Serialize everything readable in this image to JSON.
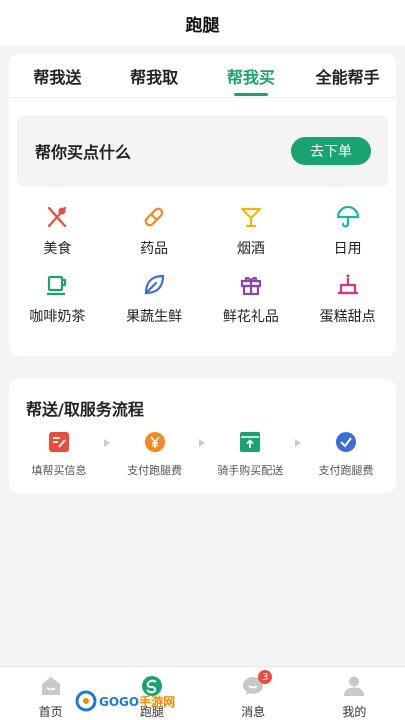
{
  "header": {
    "title": "跑腿"
  },
  "tabs": [
    {
      "label": "帮我送",
      "active": false
    },
    {
      "label": "帮我取",
      "active": false
    },
    {
      "label": "帮我买",
      "active": true
    },
    {
      "label": "全能帮手",
      "active": false
    }
  ],
  "buy_box": {
    "prompt": "帮你买点什么",
    "order_button": "去下单"
  },
  "categories": [
    {
      "label": "美食",
      "icon": "fork-knife-icon",
      "color": "#e94b3c"
    },
    {
      "label": "药品",
      "icon": "pill-icon",
      "color": "#f08a24"
    },
    {
      "label": "烟酒",
      "icon": "cocktail-icon",
      "color": "#f2b705"
    },
    {
      "label": "日用",
      "icon": "umbrella-icon",
      "color": "#20b2aa"
    },
    {
      "label": "咖啡奶茶",
      "icon": "coffee-cup-icon",
      "color": "#1aa36f"
    },
    {
      "label": "果蔬生鲜",
      "icon": "leaf-icon",
      "color": "#3b6fd6"
    },
    {
      "label": "鲜花礼品",
      "icon": "gift-icon",
      "color": "#8e44ad"
    },
    {
      "label": "蛋糕甜点",
      "icon": "cake-icon",
      "color": "#d63384"
    }
  ],
  "flow": {
    "title": "帮送/取服务流程",
    "steps": [
      {
        "label": "填帮买信息",
        "icon": "edit-form-icon",
        "color": "#e94b3c"
      },
      {
        "label": "支付跑腿费",
        "icon": "yen-coin-icon",
        "color": "#f08a24"
      },
      {
        "label": "骑手购买配送",
        "icon": "delivery-box-icon",
        "color": "#1aa36f"
      },
      {
        "label": "支付跑腿费",
        "icon": "check-circle-icon",
        "color": "#3b6fd6"
      }
    ]
  },
  "bottom_nav": [
    {
      "label": "首页",
      "icon": "home-icon"
    },
    {
      "label": "跑腿",
      "icon": "errand-logo-icon"
    },
    {
      "label": "消息",
      "icon": "chat-bubble-icon",
      "badge": "3"
    },
    {
      "label": "我的",
      "icon": "person-icon"
    }
  ],
  "watermark": {
    "brand_a": "GOGO",
    "brand_b": "手游网"
  },
  "colors": {
    "accent": "#1aa36f",
    "badge": "#e94b3c",
    "background": "#f4f4f4"
  }
}
